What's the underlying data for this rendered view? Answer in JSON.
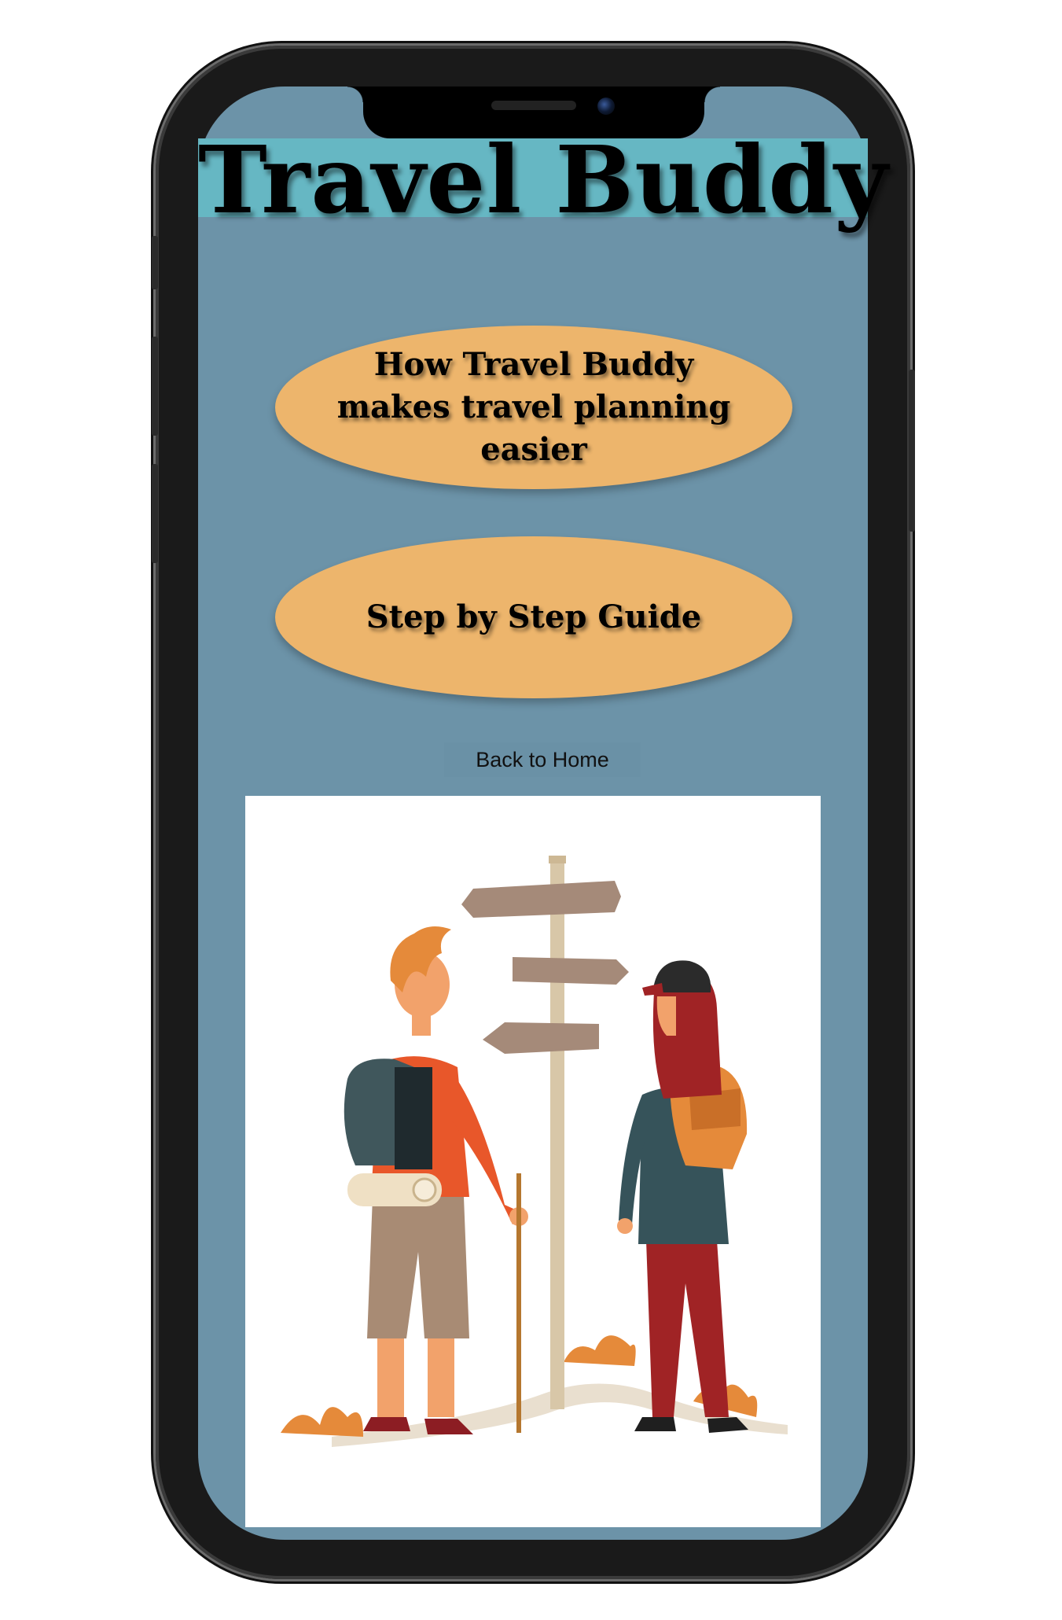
{
  "app": {
    "title": "Travel Buddy"
  },
  "menu": {
    "how_it_works_label": "How Travel Buddy makes travel planning easier",
    "guide_label": "Step by Step Guide"
  },
  "nav": {
    "back_label": "Back to Home"
  },
  "colors": {
    "screen_background": "#6c93a8",
    "title_bar": "#66b7c3",
    "button_fill": "#edb56c"
  },
  "illustration": {
    "icon": "hikers-at-signpost-illustration"
  }
}
